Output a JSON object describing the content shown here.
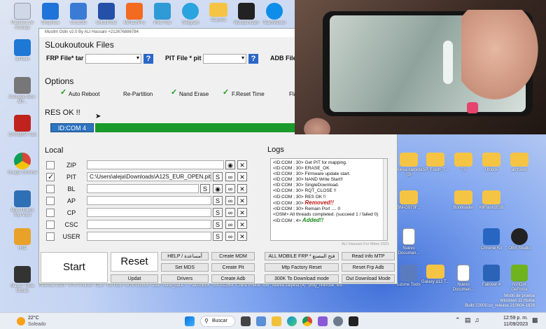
{
  "desktop": {
    "icons_left": [
      "Papelera de reciclaje",
      "3uTools",
      "Avengers Box-MT...",
      "CHIMERA Tool",
      "Google Chrome",
      "Multi Unlock Tool V2.0",
      "HxD",
      "Master Tools Mobile"
    ],
    "icons_top": [
      "ShopNow",
      "UltraISO",
      "UnlockTool",
      "MiFlashPro",
      "iFixit Tool",
      "Telegram",
      "Carpeta",
      "Wondershare",
      "TeamViewer"
    ],
    "icons_right": [
      "Nueva carpeta (3)",
      "SP_Flash_T...",
      "TS",
      "Unlock",
      "archivos",
      "SM-G973F...",
      "Bootloader",
      "MiFlash2018",
      "Nuevo Documen...",
      "Chrome Kit",
      "OBS Studio",
      "Lizone Tools",
      "Galaxy a12 T...",
      "Nuevo Documen...",
      "Failover 4",
      "NVIDIA GeForce"
    ],
    "taskbar_file_row": [
      "Motorola 2023",
      "MTK Android",
      "Odin",
      "mb Odin",
      "MTK Unlock",
      "shell",
      "nube_back...",
      "FalconBox",
      "SM-A125M",
      "China Phone Tool",
      "Nueva carpeta (4)",
      "prog_firehose",
      "ets"
    ],
    "watermark": [
      "Modo de prueba",
      "Windows 11 Home",
      "Build 22000.co_release.210604-1628"
    ]
  },
  "app": {
    "window_title": "Muslim Odin v2.0 By ALI Hassani +212676886784",
    "files_header": "SLoukoutouk Files",
    "frp_label": "FRP File* tar",
    "pit_label": "PIT File * pit",
    "adb_label": "ADB File",
    "options_header": "Options",
    "options": [
      {
        "label": "Auto Reboot",
        "checked": true
      },
      {
        "label": "Re-Partition",
        "checked": false
      },
      {
        "label": "Nand Erase",
        "checked": true
      },
      {
        "label": "F.Reset Time",
        "checked": true
      },
      {
        "label": "Flash Lock",
        "checked": false
      }
    ],
    "status": "RES OK !!",
    "com_port": "ID:COM 4",
    "local_header": "Local",
    "logs_header": "Logs",
    "rows": [
      {
        "label": "ZIP",
        "checked": false,
        "path": ""
      },
      {
        "label": "PIT",
        "checked": true,
        "path": "C:\\Users\\aleja\\Downloads\\A12S_EUR_OPEN.pit"
      },
      {
        "label": "BL",
        "checked": false,
        "path": ""
      },
      {
        "label": "AP",
        "checked": false,
        "path": ""
      },
      {
        "label": "CP",
        "checked": false,
        "path": ""
      },
      {
        "label": "CSC",
        "checked": false,
        "path": ""
      },
      {
        "label": "USER",
        "checked": false,
        "path": ""
      }
    ],
    "log_lines": [
      "<ID:COM ; 30> Get PIT for mapping.",
      "<ID:COM ; 30> ERASE_OK",
      "<ID:COM ; 30> Firmware update start.",
      "<ID:COM ; 30> NAND Write Start!!",
      "<ID:COM ; 30> SingleDownload.",
      "<ID:COM ; 30> RQT_CLOSE !!",
      "<ID:COM ; 30> RES OK !!"
    ],
    "log_removed_prefix": "<ID:COM ; 30>",
    "log_removed": "Removed!!",
    "log_tail": [
      "<ID:COM ; 30> Remain Port ....  0",
      "<OSM> All threads completed. (succeed 1 / failed 0)"
    ],
    "log_added_prefix": "<ID:COM ; 4>",
    "log_added": "Added!!",
    "credit": "ALI Hassani For Mimo 2021",
    "start_label": "Start",
    "reset_label": "Reset",
    "buttons": {
      "help": "HELP / أمساعدة",
      "set_mds": "Set MDS",
      "drivers": "Drivers",
      "updat": "Updat",
      "create_mdm": "Create MDM",
      "create_pit": "Create Pit",
      "create_adb": "Create Adb",
      "all_mobile_frp": "ALL MOBILE FRP * فتح المصنع",
      "mtp_factory_reset": "Mtp Factory Reset",
      "k300_to_download": "300K To Download mode",
      "read_info_mtp": "Read Info MTP",
      "reset_frp_adb": "Reset Frp Adb",
      "out_download_mode": "Out Download Mode"
    }
  },
  "taskbar": {
    "weather_temp": "22°C",
    "weather_desc": "Soleado",
    "search_label": "Buscar",
    "time": "12:59 p. m.",
    "date": "11/09/2023"
  },
  "colors": {
    "accent_blue": "#2a67c8",
    "progress_green": "#1a9a2a",
    "com_badge": "#2e74c0"
  }
}
